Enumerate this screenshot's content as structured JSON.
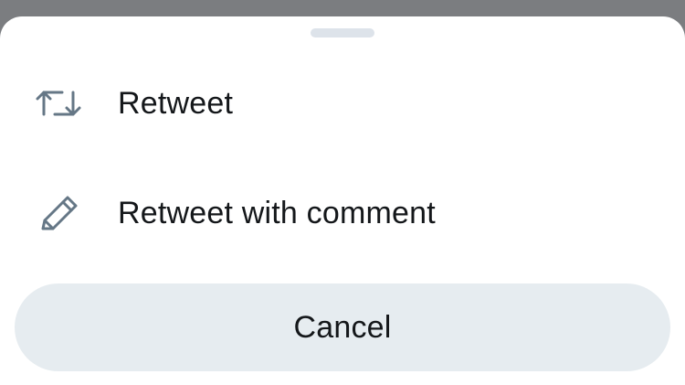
{
  "sheet": {
    "options": [
      {
        "label": "Retweet",
        "icon": "retweet-icon"
      },
      {
        "label": "Retweet with comment",
        "icon": "pencil-icon"
      }
    ],
    "cancel_label": "Cancel"
  },
  "colors": {
    "backdrop": "#7b7d80",
    "sheet_background": "#ffffff",
    "text": "#14171a",
    "icon": "#657786",
    "cancel_background": "#e6ecf0",
    "grabber": "#dde3ea"
  }
}
